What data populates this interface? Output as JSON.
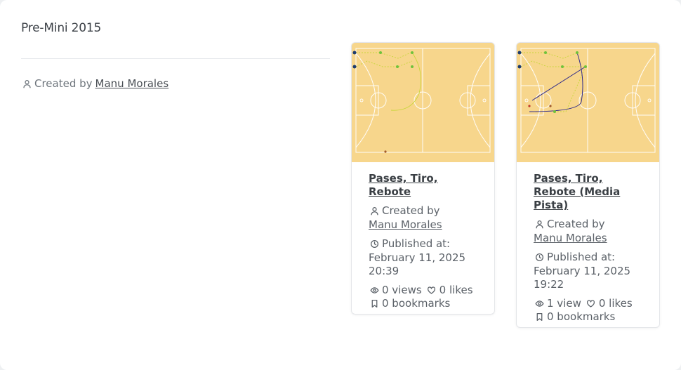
{
  "collection": {
    "title": "Pre-Mini 2015",
    "created_by_prefix": "Created by",
    "author": "Manu Morales"
  },
  "cards": [
    {
      "title": "Pases, Tiro, Rebote",
      "created_by_prefix": "Created by",
      "author": "Manu Morales",
      "published_prefix": "Published at:",
      "published_date": "February 11, 2025",
      "published_time": "20:39",
      "views": "0 views",
      "likes": "0 likes",
      "bookmarks": "0 bookmarks"
    },
    {
      "title": "Pases, Tiro, Rebote (Media Pista)",
      "created_by_prefix": "Created by",
      "author": "Manu Morales",
      "published_prefix": "Published at:",
      "published_date": "February 11, 2025",
      "published_time": "19:22",
      "views": "1 view",
      "likes": "0 likes",
      "bookmarks": "0 bookmarks"
    }
  ],
  "colors": {
    "court": "#f7d68c",
    "court_lines": "#ffffff",
    "pass_line": "#c8d63a",
    "cut_line": "#2e2a8a"
  },
  "icons": {
    "user": "user-icon",
    "clock": "clock-icon",
    "eye": "eye-icon",
    "heart": "heart-icon",
    "bookmark": "bookmark-icon"
  }
}
